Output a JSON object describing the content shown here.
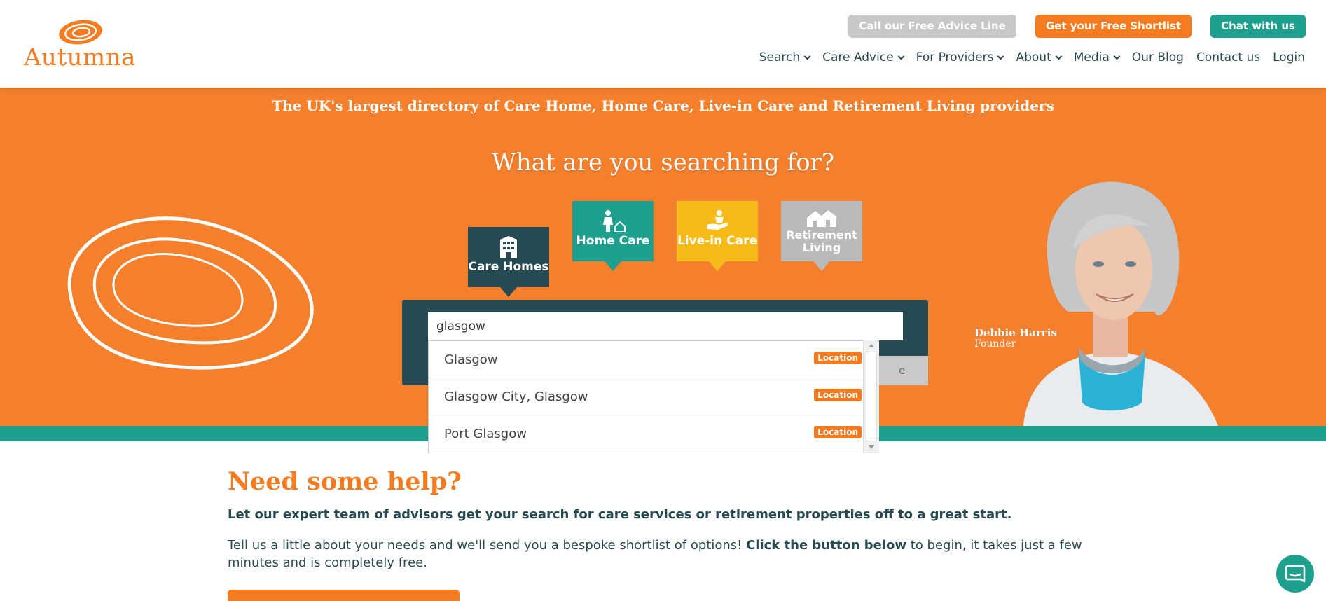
{
  "brand": {
    "name": "Autumna",
    "accent": "#f47b20",
    "teal": "#1fa08f",
    "dark": "#264a51"
  },
  "header": {
    "top_buttons": {
      "advice": "Call our Free Advice Line",
      "shortlist": "Get your Free Shortlist",
      "chat": "Chat with us"
    },
    "nav": {
      "search": "Search",
      "care_advice": "Care Advice",
      "providers": "For Providers",
      "about": "About",
      "media": "Media",
      "blog": "Our Blog",
      "contact": "Contact us",
      "login": "Login"
    }
  },
  "hero": {
    "tagline": "The UK's largest directory of Care Home, Home Care, Live-in Care and Retirement Living providers",
    "heading": "What are you searching for?",
    "categories": {
      "care_homes": "Care Homes",
      "home_care": "Home Care",
      "live_in_care": "Live-in Care",
      "retirement_line1": "Retirement",
      "retirement_line2": "Living"
    },
    "search": {
      "value": "glasgow",
      "button_fragment": "e"
    },
    "founder": {
      "name": "Debbie Harris",
      "role": "Founder"
    }
  },
  "autocomplete": {
    "items": [
      {
        "label": "Glasgow",
        "badge": "Location"
      },
      {
        "label": "Glasgow City, Glasgow",
        "badge": "Location"
      },
      {
        "label": "Port Glasgow",
        "badge": "Location"
      }
    ]
  },
  "help": {
    "title": "Need some help?",
    "lead": "Let our expert team of advisors get your search for care services or retirement properties off to a great start.",
    "body_part1": "Tell us a little about your needs and we'll send you a bespoke shortlist of options! ",
    "body_bold": "Click the button below",
    "body_part2": " to begin, it takes just a few minutes and is completely free."
  }
}
